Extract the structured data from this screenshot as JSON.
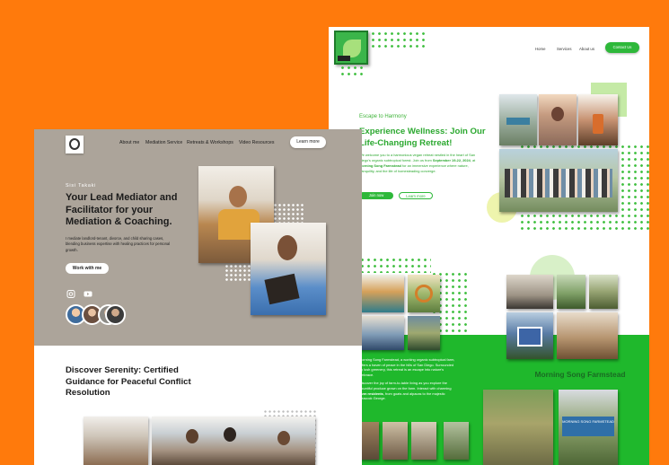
{
  "retreat_site": {
    "nav": [
      "Home",
      "Services",
      "About us"
    ],
    "contact_label": "Contact Us",
    "eyebrow": "Escape to Harmony",
    "title": "Experience Wellness: Join Our Life-Changing Retreat!",
    "intro_pre": "We welcome you to a harmonious vegan retreat nestled in the heart of San Diego's organic subtropical forest. Join us from ",
    "intro_dates": "September 19-22, 2024",
    "intro_mid": ", at ",
    "intro_place": "Morning Song Farmstead",
    "intro_post": " for an immersive experience where nature, tranquility, and the life of homesteading converge.",
    "join_label": "Join now",
    "learn_label": "Learn more",
    "farm_title": "Morning Song Farmstead",
    "farm_p1": "Morning Song Farmstead, a working organic subtropical farm, offers a haven of peace in the hills of San Diego. Surrounded by lush greenery, this retreat is an escape into nature's embrace.",
    "farm_p2_pre": "Discover the joy of farm-to-table living as you explore the bountiful produce grown on the farm. Interact with charming ",
    "farm_p2_bold": "farm residents",
    "farm_p2_post": ", from goats and alpacas to the majestic peacock George.",
    "sign_text": "MORNING SONG FARMSTEAD"
  },
  "mediator_site": {
    "nav": [
      "About me",
      "Mediation Service",
      "Retreats & Workshops",
      "Video Resources"
    ],
    "learn_label": "Learn more",
    "name": "Sisi Takaki",
    "title": "Your Lead Mediator and Facilitator for your Mediation & Coaching.",
    "body": "I mediate landlord-tenant, divorce, and child sharing cases, blending business expertise with healing practices for personal growth.",
    "work_label": "Work with me",
    "section_title": "Discover Serenity: Certified Guidance for Peaceful Conflict Resolution"
  },
  "colors": {
    "background": "#ff7a0c",
    "accent_green": "#2eb83a",
    "hero_taupe": "#aca49a"
  },
  "icons": [
    "instagram-icon",
    "youtube-icon",
    "logo-leaf-icon",
    "logo-circle-icon"
  ]
}
